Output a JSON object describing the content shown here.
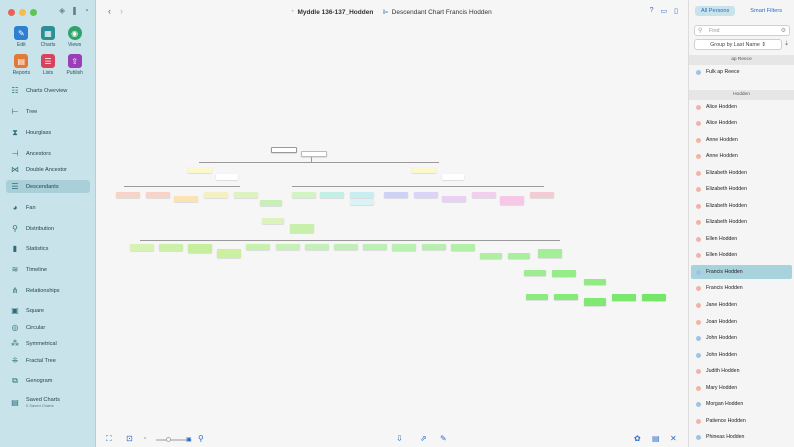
{
  "toolbar": {
    "tools": [
      {
        "label": "Edit",
        "icon": "pencil-icon"
      },
      {
        "label": "Charts",
        "icon": "charts-icon"
      },
      {
        "label": "Views",
        "icon": "eye-icon"
      },
      {
        "label": "Reports",
        "icon": "reports-icon"
      },
      {
        "label": "Lists",
        "icon": "lists-icon"
      },
      {
        "label": "Publish",
        "icon": "publish-icon"
      }
    ]
  },
  "sidebar": {
    "items": [
      {
        "label": "Charts Overview",
        "icon": "charts-overview-icon"
      },
      {
        "label": "Tree",
        "icon": "tree-icon"
      },
      {
        "label": "Hourglass",
        "icon": "hourglass-icon"
      },
      {
        "label": "Ancestors",
        "icon": "ancestors-icon"
      },
      {
        "label": "Double Ancestor",
        "icon": "double-ancestor-icon"
      },
      {
        "label": "Descendants",
        "icon": "descendants-icon",
        "active": true
      },
      {
        "label": "Fan",
        "icon": "fan-icon"
      },
      {
        "label": "Distribution",
        "icon": "distribution-icon"
      },
      {
        "label": "Statistics",
        "icon": "statistics-icon"
      },
      {
        "label": "Timeline",
        "icon": "timeline-icon"
      },
      {
        "label": "Relationships",
        "icon": "relationships-icon"
      },
      {
        "label": "Square",
        "icon": "square-icon"
      },
      {
        "label": "Circular",
        "icon": "circular-icon"
      },
      {
        "label": "Symmetrical",
        "icon": "symmetrical-icon"
      },
      {
        "label": "Fractal Tree",
        "icon": "fractal-tree-icon"
      },
      {
        "label": "Genogram",
        "icon": "genogram-icon"
      },
      {
        "label": "Saved Charts",
        "sub": "0 Saved Charts",
        "icon": "saved-charts-icon"
      }
    ]
  },
  "header": {
    "database": "Myddle 136-137_Hodden",
    "chart_title": "Descendant Chart Francis  Hodden"
  },
  "right_panel": {
    "tab_all": "All Persons",
    "tab_smart": "Smart Filters",
    "search_placeholder": "Find",
    "group_by": "Group by Last Name",
    "sections": [
      {
        "name": "ap Reece",
        "persons": [
          {
            "name": "Fulk  ap Reece",
            "sex": "m"
          }
        ]
      },
      {
        "name": "Hodden",
        "persons": [
          {
            "name": "Alice Hodden",
            "sex": "f"
          },
          {
            "name": "Alice Hodden",
            "sex": "f"
          },
          {
            "name": "Anne Hodden",
            "sex": "f"
          },
          {
            "name": "Anne Hodden",
            "sex": "f"
          },
          {
            "name": "Elizabeth Hodden",
            "sex": "f"
          },
          {
            "name": "Elizabeth Hodden",
            "sex": "f"
          },
          {
            "name": "Elizabeth Hodden",
            "sex": "f"
          },
          {
            "name": "Elizabeth Hodden",
            "sex": "f"
          },
          {
            "name": "Ellen Hodden",
            "sex": "f"
          },
          {
            "name": "Ellen Hodden",
            "sex": "f"
          },
          {
            "name": "Francis  Hodden",
            "sex": "m",
            "selected": true
          },
          {
            "name": "Francis Hodden",
            "sex": "f"
          },
          {
            "name": "Jane Hodden",
            "sex": "f"
          },
          {
            "name": "Joan Hodden",
            "sex": "f"
          },
          {
            "name": "John Hodden",
            "sex": "m"
          },
          {
            "name": "John Hodden",
            "sex": "m"
          },
          {
            "name": "Judith Hodden",
            "sex": "f"
          },
          {
            "name": "Mary Hodden",
            "sex": "f"
          },
          {
            "name": "Morgan Hodden",
            "sex": "m"
          },
          {
            "name": "Patience Hodden",
            "sex": "f"
          },
          {
            "name": "Phineas Hodden",
            "sex": "m"
          }
        ]
      }
    ]
  },
  "colors": {
    "sidebar_bg": "#c9e3ea",
    "accent": "#2a6bc9",
    "selected_row": "#a9d3dc",
    "male_dot": "#9ec3e6",
    "female_dot": "#f1b3a7"
  }
}
